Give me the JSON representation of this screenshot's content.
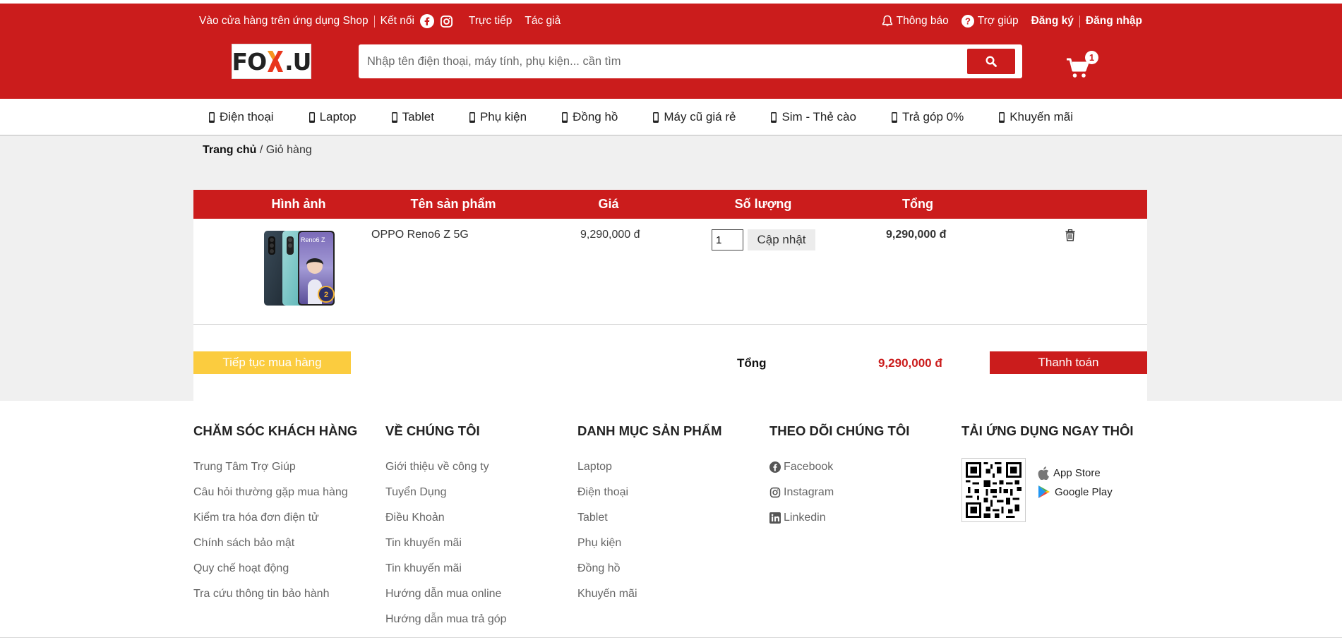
{
  "topbar": {
    "app_link": "Vào cửa hàng trên ứng dụng Shop",
    "connect": "Kết nối",
    "live": "Trực tiếp",
    "author": "Tác giả",
    "notifications": "Thông báo",
    "help": "Trợ giúp",
    "register": "Đăng ký",
    "login": "Đăng nhập"
  },
  "header": {
    "logo_text_left": "FO",
    "logo_text_right": ".U",
    "search_placeholder": "Nhập tên điện thoại, máy tính, phụ kiện... cần tìm",
    "cart_count": "1"
  },
  "nav": {
    "items": [
      "Điện thoại",
      "Laptop",
      "Tablet",
      "Phụ kiện",
      "Đồng hồ",
      "Máy cũ giá rẻ",
      "Sim - Thẻ cào",
      "Trả góp 0%",
      "Khuyến mãi"
    ]
  },
  "breadcrumb": {
    "home": "Trang chủ",
    "current": "/ Giỏ hàng"
  },
  "cart": {
    "headers": {
      "image": "Hình ảnh",
      "name": "Tên sản phẩm",
      "price": "Giá",
      "qty": "Số lượng",
      "total": "Tổng"
    },
    "item": {
      "name": "OPPO Reno6 Z 5G",
      "price": "9,290,000 đ",
      "qty": "1",
      "update_label": "Cập nhật",
      "total": "9,290,000 đ"
    },
    "continue_label": "Tiếp tục mua hàng",
    "sum_label": "Tổng",
    "sum_value": "9,290,000 đ",
    "checkout_label": "Thanh toán"
  },
  "footer": {
    "care": {
      "title": "CHĂM SÓC KHÁCH HÀNG",
      "links": [
        "Trung Tâm Trợ Giúp",
        "Câu hỏi thường gặp mua hàng",
        "Kiểm tra hóa đơn điện tử",
        "Chính sách bảo mật",
        "Quy chế hoạt động",
        "Tra cứu thông tin bảo hành"
      ]
    },
    "about": {
      "title": "VỀ CHÚNG TÔI",
      "links": [
        "Giới thiệu về công ty",
        "Tuyển Dụng",
        "Điều Khoản",
        "Tin khuyến mãi",
        "Tin khuyến mãi",
        "Hướng dẫn mua online",
        "Hướng dẫn mua trả góp"
      ]
    },
    "categories": {
      "title": "DANH MỤC SẢN PHẨM",
      "links": [
        "Laptop",
        "Điện thoại",
        "Tablet",
        "Phụ kiện",
        "Đồng hồ",
        "Khuyến mãi"
      ]
    },
    "follow": {
      "title": "THEO DÕI CHÚNG TÔI",
      "links": [
        "Facebook",
        "Instagram",
        "Linkedin"
      ]
    },
    "app": {
      "title": "TẢI ỨNG DỤNG NGAY THÔI",
      "app_store": "App Store",
      "google_play": "Google Play"
    }
  },
  "colors": {
    "brand_red": "#cb1c1c",
    "continue_yellow": "#fbcc3f"
  }
}
